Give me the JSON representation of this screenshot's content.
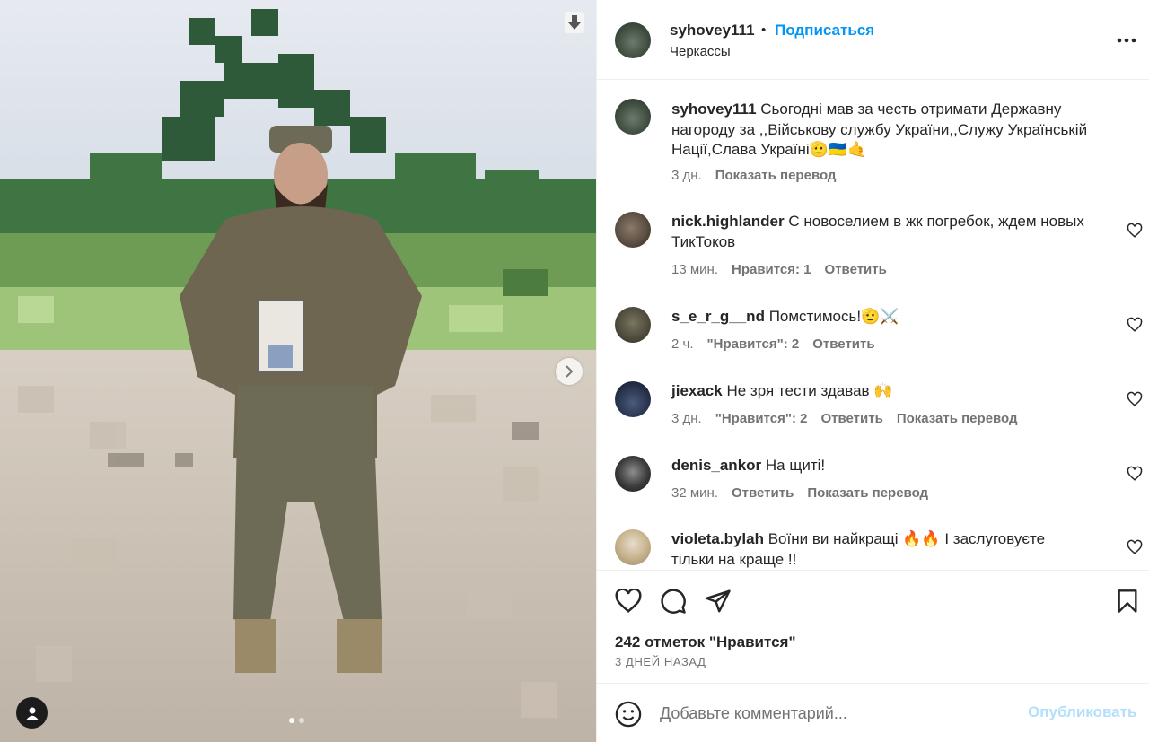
{
  "header": {
    "username": "syhovey111",
    "dot": "•",
    "follow_label": "Подписаться",
    "location": "Черкассы",
    "more_icon": "more-horizontal-icon"
  },
  "caption": {
    "username": "syhovey111",
    "text": "Сьогодні мав за честь отримати Державну нагороду за ,,Військову службу України,,Служу Українській Нації,Слава Україні🫡🇺🇦🤙",
    "time": "3 дн.",
    "translate": "Показать перевод"
  },
  "comments": [
    {
      "username": "nick.highlander",
      "text": "С новоселием в жк погребок, ждем новых ТикТоков",
      "time": "13 мин.",
      "likes": "Нравится: 1",
      "reply": "Ответить",
      "translate": ""
    },
    {
      "username": "s_e_r_g__nd",
      "text": "Помстимось!🫡⚔️",
      "time": "2 ч.",
      "likes": "\"Нравится\": 2",
      "reply": "Ответить",
      "translate": ""
    },
    {
      "username": "jiexack",
      "text": "Не зря тести здавав 🙌",
      "time": "3 дн.",
      "likes": "\"Нравится\": 2",
      "reply": "Ответить",
      "translate": "Показать перевод"
    },
    {
      "username": "denis_ankor",
      "text": "На щиті!",
      "time": "32 мин.",
      "likes": "",
      "reply": "Ответить",
      "translate": "Показать перевод"
    },
    {
      "username": "violeta.bylah",
      "text": "Воїни ви найкращі 🔥🔥 І заслуговуєте тільки на краще !!",
      "time": "",
      "likes": "",
      "reply": "",
      "translate": ""
    }
  ],
  "actions": {
    "likes_count": "242 отметок \"Нравится\"",
    "date": "3 ДНЕЙ НАЗАД"
  },
  "add_comment": {
    "placeholder": "Добавьте комментарий...",
    "publish_label": "Опубликовать"
  },
  "media": {
    "carousel_total": 2,
    "carousel_current": 1
  }
}
